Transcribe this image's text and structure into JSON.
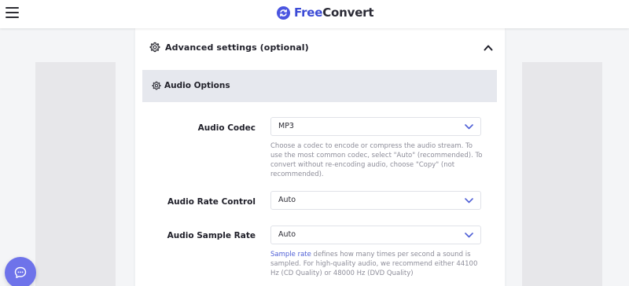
{
  "header": {
    "brand_free": "Free",
    "brand_convert": "Convert"
  },
  "advanced": {
    "title": "Advanced settings (optional)"
  },
  "audio_options": {
    "title": "Audio Options",
    "fields": [
      {
        "label": "Audio Codec",
        "value": "MP3",
        "help": "Choose a codec to encode or compress the audio stream. To use the most common codec, select \"Auto\" (recommended). To convert without re-encoding audio, choose \"Copy\" (not recommended)."
      },
      {
        "label": "Audio Rate Control",
        "value": "Auto"
      },
      {
        "label": "Audio Sample Rate",
        "value": "Auto",
        "help_link": "Sample rate",
        "help": " defines how many times per second a sound is sampled. For high-quality audio, we recommend either 44100 Hz (CD Quality) or 48000 Hz (DVD Quality)"
      }
    ]
  },
  "colors": {
    "brand": "#3c4bd6",
    "chat": "#6e73ea",
    "link": "#4f5fd6",
    "band": "#e6e8ee"
  },
  "icons": [
    "menu-icon",
    "logo-icon",
    "gear-icon",
    "chevron-up-icon",
    "chevron-down-icon",
    "chat-icon"
  ]
}
